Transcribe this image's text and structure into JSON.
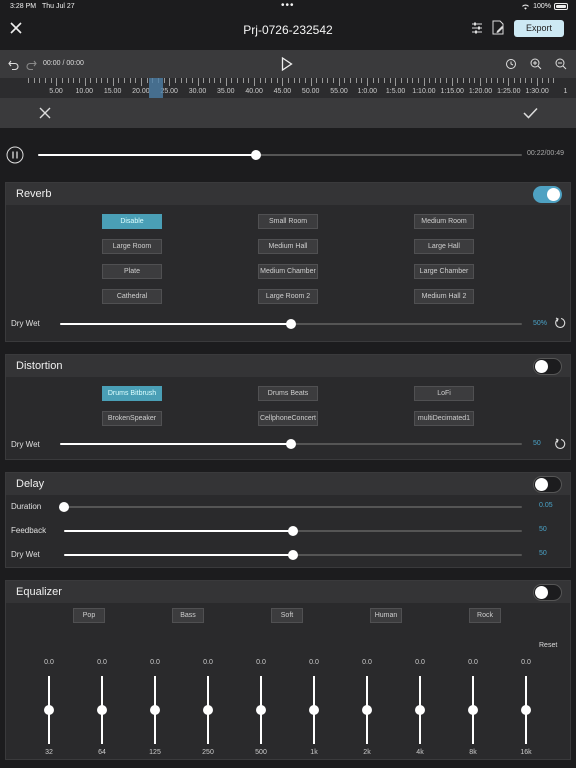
{
  "status": {
    "time": "3:28 PM",
    "date": "Thu Jul 27",
    "battery": "100%"
  },
  "header": {
    "title": "Prj-0726-232542",
    "export_label": "Export"
  },
  "timeline": {
    "time_display": "00:00 / 00:00",
    "ruler_labels": [
      "5.00",
      "10.00",
      "15.00",
      "20.00",
      "25.00",
      "30.00",
      "35.00",
      "40.00",
      "45.00",
      "50.00",
      "55.00",
      "1:0.00",
      "1:5.00",
      "1:10.00",
      "1:15.00",
      "1:20.00",
      "1:25.00",
      "1:30.00",
      "1"
    ]
  },
  "player": {
    "time": "00:22/00:49",
    "progress": 0.45
  },
  "reverb": {
    "title": "Reverb",
    "enabled": true,
    "presets": [
      "Disable",
      "Small Room",
      "Medium Room",
      "Large Room",
      "Medium Hall",
      "Large Hall",
      "Plate",
      "Medium Chamber",
      "Large Chamber",
      "Cathedral",
      "Large Room 2",
      "Medium Hall 2"
    ],
    "selected": "Disable",
    "drywet_label": "Dry Wet",
    "drywet_value": "50%",
    "drywet_level": 0.5
  },
  "distortion": {
    "title": "Distortion",
    "enabled": false,
    "presets": [
      "Drums Bitbrush",
      "Drums Beats",
      "LoFi",
      "BrokenSpeaker",
      "CellphoneConcert",
      "multiDecimated1"
    ],
    "selected": "Drums Bitbrush",
    "drywet_label": "Dry Wet",
    "drywet_value": "50",
    "drywet_level": 0.5
  },
  "delay": {
    "title": "Delay",
    "enabled": false,
    "rows": [
      {
        "label": "Duration",
        "value": "0.05",
        "level": 0.0
      },
      {
        "label": "Feedback",
        "value": "50",
        "level": 0.5
      },
      {
        "label": "Dry Wet",
        "value": "50",
        "level": 0.5
      }
    ]
  },
  "equalizer": {
    "title": "Equalizer",
    "enabled": false,
    "presets": [
      "Pop",
      "Bass",
      "Soft",
      "Human",
      "Rock"
    ],
    "reset_label": "Reset",
    "bands": [
      {
        "freq": "32",
        "gain": "0.0"
      },
      {
        "freq": "64",
        "gain": "0.0"
      },
      {
        "freq": "125",
        "gain": "0.0"
      },
      {
        "freq": "250",
        "gain": "0.0"
      },
      {
        "freq": "500",
        "gain": "0.0"
      },
      {
        "freq": "1k",
        "gain": "0.0"
      },
      {
        "freq": "2k",
        "gain": "0.0"
      },
      {
        "freq": "4k",
        "gain": "0.0"
      },
      {
        "freq": "8k",
        "gain": "0.0"
      },
      {
        "freq": "16k",
        "gain": "0.0"
      }
    ]
  },
  "colors": {
    "accent": "#4a9fb6",
    "export_bg": "#cde9f4"
  }
}
